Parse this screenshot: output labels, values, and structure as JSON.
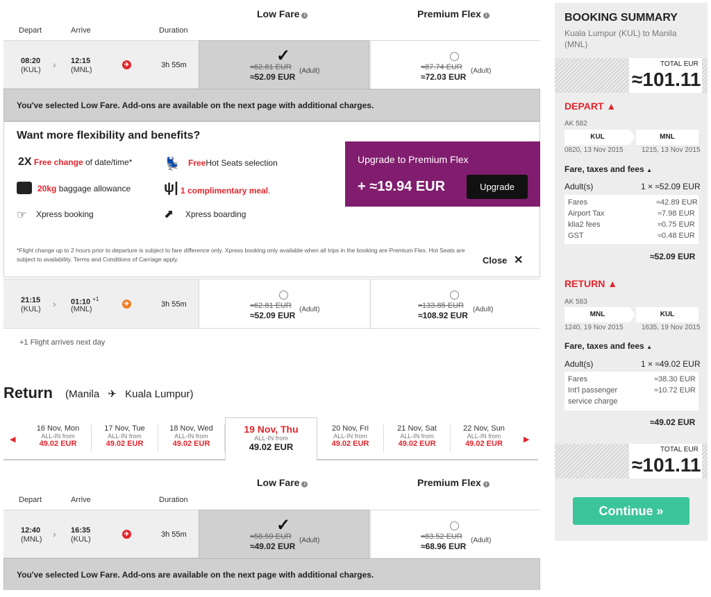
{
  "depart_section": {
    "fare_headers": [
      "Low Fare",
      "Premium Flex"
    ],
    "col_headers": {
      "depart": "Depart",
      "arrive": "Arrive",
      "duration": "Duration"
    },
    "flights": [
      {
        "dep_time": "08:20",
        "dep_code": "(KUL)",
        "arr_time": "12:15",
        "arr_suffix": "",
        "arr_code": "(MNL)",
        "duration": "3h 55m",
        "low": {
          "was": "≈62.81 EUR",
          "now": "≈52.09 EUR",
          "note": "(Adult)"
        },
        "flex": {
          "was": "≈87.74 EUR",
          "now": "≈72.03 EUR",
          "note": "(Adult)"
        }
      },
      {
        "dep_time": "21:15",
        "dep_code": "(KUL)",
        "arr_time": "01:10",
        "arr_suffix": "+1",
        "arr_code": "(MNL)",
        "duration": "3h 55m",
        "low": {
          "was": "≈62.81 EUR",
          "now": "≈52.09 EUR",
          "note": "(Adult)"
        },
        "flex": {
          "was": "≈133.85 EUR",
          "now": "≈108.92 EUR",
          "note": "(Adult)"
        }
      }
    ],
    "selected_msg": "You've selected Low Fare. Add-ons are available on the next page with additional charges.",
    "next_day_note": "+1 Flight arrives next day"
  },
  "flex_panel": {
    "title": "Want more flexibility and benefits?",
    "features": {
      "change_prefix": "2X",
      "change_red": "Free change",
      "change_rest": "of date/time*",
      "seats_red": "Free",
      "seats_rest": "Hot Seats selection",
      "bag_red": "20kg",
      "bag_rest": "baggage allowance",
      "meal_red": "1 complimentary meal",
      "meal_dot": ".",
      "xpress_booking": "Xpress booking",
      "xpress_boarding": "Xpress boarding"
    },
    "upgrade_title": "Upgrade to Premium Flex",
    "upgrade_price": "+ ≈19.94 EUR",
    "upgrade_button": "Upgrade",
    "footnote": "*Flight change up to 2 hours prior to departure is subject to fare difference only. Xpress booking only available when all trips in the booking are Premium Flex. Hot Seats are subject to availability. Terms and Conditions of Carriage apply.",
    "close_label": "Close"
  },
  "return_section": {
    "title": "Return",
    "from": "(Manila",
    "to": "Kuala Lumpur)",
    "days": [
      {
        "date": "16 Nov, Mon",
        "label": "ALL-IN from",
        "amount": "49.02 EUR"
      },
      {
        "date": "17 Nov, Tue",
        "label": "ALL-IN from",
        "amount": "49.02 EUR"
      },
      {
        "date": "18 Nov, Wed",
        "label": "ALL-IN from",
        "amount": "49.02 EUR"
      },
      {
        "date": "19 Nov, Thu",
        "label": "ALL-IN from",
        "amount": "49.02 EUR"
      },
      {
        "date": "20 Nov, Fri",
        "label": "ALL-IN from",
        "amount": "49.02 EUR"
      },
      {
        "date": "21 Nov, Sat",
        "label": "ALL-IN from",
        "amount": "49.02 EUR"
      },
      {
        "date": "22 Nov, Sun",
        "label": "ALL-IN from",
        "amount": "49.02 EUR"
      }
    ],
    "fare_headers": [
      "Low Fare",
      "Premium Flex"
    ],
    "col_headers": {
      "depart": "Depart",
      "arrive": "Arrive",
      "duration": "Duration"
    },
    "flight": {
      "dep_time": "12:40",
      "dep_code": "(MNL)",
      "arr_time": "16:35",
      "arr_code": "(KUL)",
      "duration": "3h 55m",
      "low": {
        "was": "≈58.59 EUR",
        "now": "≈49.02 EUR",
        "note": "(Adult)"
      },
      "flex": {
        "was": "≈83.52 EUR",
        "now": "≈68.96 EUR",
        "note": "(Adult)"
      }
    },
    "selected_msg": "You've selected Low Fare. Add-ons are available on the next page with additional charges."
  },
  "summary": {
    "title": "BOOKING SUMMARY",
    "route": "Kuala Lumpur (KUL) to Manila (MNL)",
    "total_label": "TOTAL EUR",
    "total": "≈101.11",
    "depart": {
      "label": "DEPART",
      "flight": "AK 582",
      "from": "KUL",
      "to": "MNL",
      "from_time": "0820, 13 Nov 2015",
      "to_time": "1215, 13 Nov 2015",
      "fees_title": "Fare, taxes and fees",
      "adult_label": "Adult(s)",
      "adult_value": "1 × ≈52.09 EUR",
      "lines": [
        {
          "k": "Fares",
          "v": "≈42.89 EUR"
        },
        {
          "k": "Airport Tax",
          "v": "≈7.98 EUR"
        },
        {
          "k": "klia2 fees",
          "v": "≈0.75 EUR"
        },
        {
          "k": "GST",
          "v": "≈0.48 EUR"
        }
      ],
      "subtotal": "≈52.09 EUR"
    },
    "return": {
      "label": "RETURN",
      "flight": "AK 583",
      "from": "MNL",
      "to": "KUL",
      "from_time": "1240, 19 Nov 2015",
      "to_time": "1635, 19 Nov 2015",
      "fees_title": "Fare, taxes and fees",
      "adult_label": "Adult(s)",
      "adult_value": "1 × ≈49.02 EUR",
      "lines": [
        {
          "k": "Fares",
          "v": "≈38.30 EUR"
        },
        {
          "k": "Int'l passenger",
          "v": "≈10.72 EUR"
        },
        {
          "k": "service charge",
          "v": ""
        }
      ],
      "subtotal": "≈49.02 EUR"
    },
    "total2_label": "TOTAL EUR",
    "total2": "≈101.11",
    "continue_label": "Continue »"
  }
}
